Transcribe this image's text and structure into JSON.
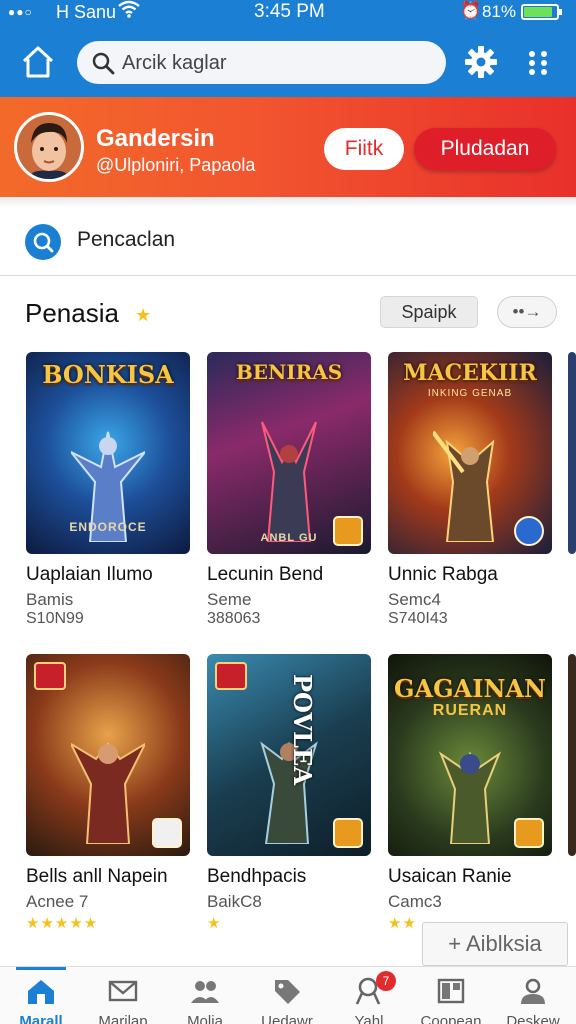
{
  "status_bar": {
    "carrier": "H Sanu",
    "time": "3:45 PM",
    "battery_pct": "81%"
  },
  "header": {
    "search_placeholder": "Arcik kaglar"
  },
  "profile": {
    "name": "Gandersin",
    "handle": "@Ulploniri, Papaola",
    "btn_secondary": "Fiitk",
    "btn_primary": "Pludadan"
  },
  "filter": {
    "label": "Pencaclan"
  },
  "section": {
    "title": "Penasia",
    "btn_label": "Spaipk",
    "more_label": "••→"
  },
  "cards": [
    {
      "title": "Uaplaian Ilumo",
      "sub": "Bamis",
      "price": "S10N99",
      "art_title": "BONKISA",
      "art_sub": "",
      "art_foot": "ENDOROCE"
    },
    {
      "title": "Lecunin Bend",
      "sub": "Seme",
      "price": "388063",
      "art_title": "BENIRAS",
      "art_sub": "",
      "art_foot": "ANBL GU"
    },
    {
      "title": "Unnic Rabga",
      "sub": "Semc4",
      "price": "S740I43",
      "art_title": "MACEKIIR",
      "art_sub": "INKING GENAB",
      "art_foot": ""
    },
    {
      "title": "Bells anll Napein",
      "sub": "Acnee 7",
      "rating": "★★★★★",
      "art_title": "",
      "art_sub": "",
      "art_foot": ""
    },
    {
      "title": "Bendhpacis",
      "sub": "BaikC8",
      "rating": "★",
      "art_title": "POVLEA",
      "art_sub": "",
      "art_foot": ""
    },
    {
      "title": "Usaican Ranie",
      "sub": "Camc3",
      "rating": "★★",
      "art_title": "GAGAINAN",
      "art_sub": "RUERAN",
      "art_foot": ""
    }
  ],
  "toast": "+ Aiblksia",
  "bottom_nav": [
    {
      "label": "Marall",
      "icon": "home-icon",
      "active": true
    },
    {
      "label": "Marilap",
      "icon": "mail-icon"
    },
    {
      "label": "Molia",
      "icon": "people-icon"
    },
    {
      "label": "Uedawr",
      "icon": "tag-icon"
    },
    {
      "label": "Yahl",
      "icon": "pin-icon",
      "badge": "7"
    },
    {
      "label": "Coopean",
      "icon": "layout-icon"
    },
    {
      "label": "Deskew",
      "icon": "person-icon"
    }
  ],
  "colors": {
    "primary_blue": "#1b7fd4",
    "banner_orange": "#f26a2a",
    "banner_red": "#e8302b",
    "button_red": "#de1f2a",
    "star": "#f4c21b"
  }
}
